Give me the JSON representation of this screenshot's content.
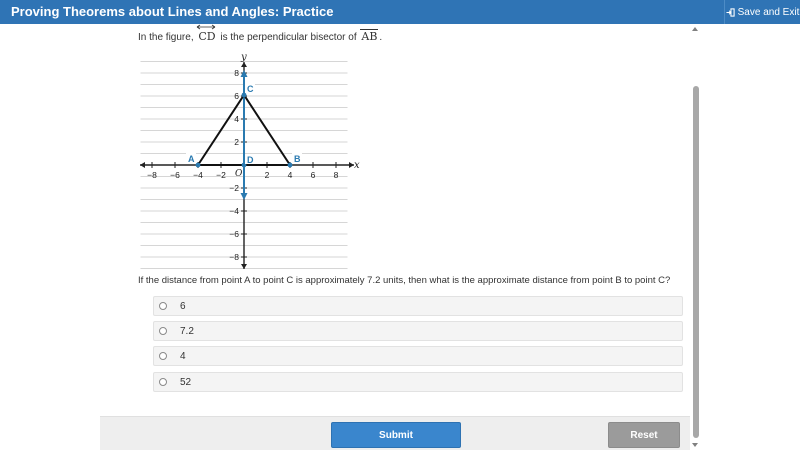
{
  "header": {
    "title": "Proving Theorems about Lines and Angles: Practice",
    "save_exit_label": "Save and Exit"
  },
  "prompt": {
    "prefix": "In the figure,",
    "line_name": "CD",
    "middle": "is the perpendicular bisector of",
    "segment_name": "AB",
    "suffix": "."
  },
  "graph": {
    "x_axis_label": "x",
    "y_axis_label": "y",
    "origin_label": "O",
    "x_ticks": [
      "−8",
      "−6",
      "−4",
      "−2",
      "2",
      "4",
      "6",
      "8"
    ],
    "y_ticks_pos": [
      "8",
      "6",
      "4",
      "2"
    ],
    "y_ticks_neg": [
      "−2",
      "−4",
      "−6",
      "−8"
    ],
    "points": {
      "A": "A",
      "B": "B",
      "C": "C",
      "D": "D"
    },
    "colors": {
      "grid": "#c8c8c8",
      "axis": "#222222",
      "point": "#2a7ab0",
      "triangle": "#111111"
    }
  },
  "question": "If the distance from point A to point C is approximately 7.2 units, then what is the approximate distance from point B to point C?",
  "choices": [
    "6",
    "7.2",
    "4",
    "52"
  ],
  "buttons": {
    "submit": "Submit",
    "reset": "Reset"
  }
}
